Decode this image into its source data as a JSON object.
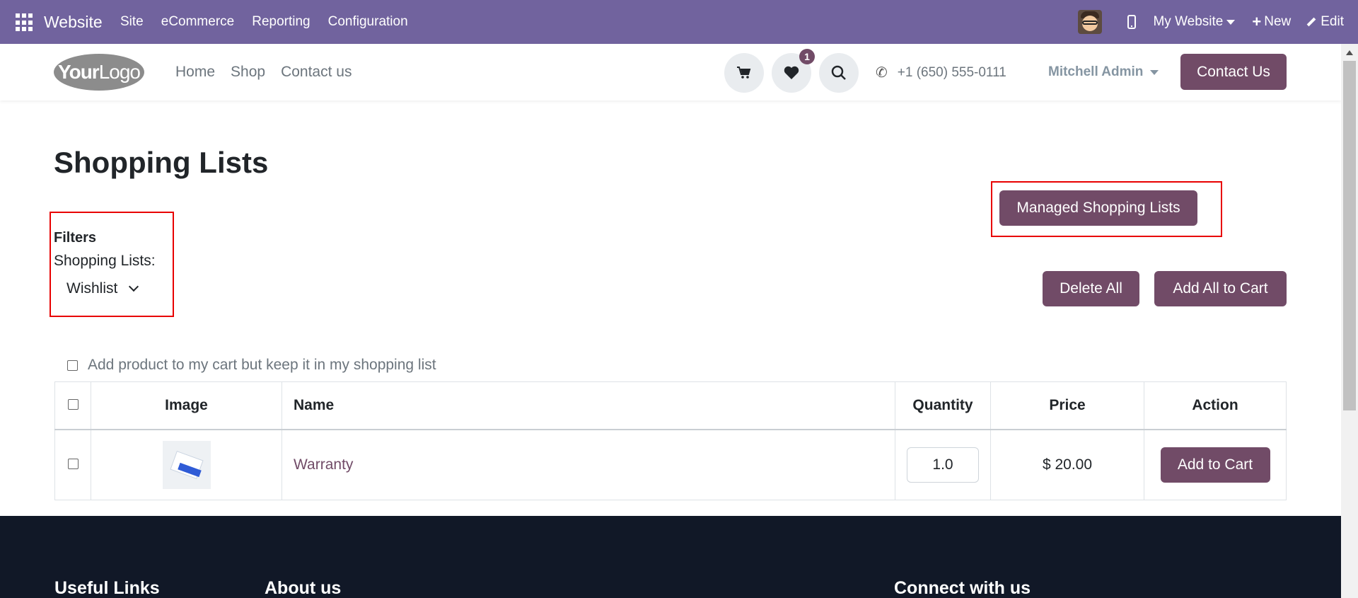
{
  "admin_bar": {
    "brand": "Website",
    "menu": [
      "Site",
      "eCommerce",
      "Reporting",
      "Configuration"
    ],
    "site_selector": "My Website",
    "new_label": "New",
    "edit_label": "Edit"
  },
  "header": {
    "logo_text_bold": "Your",
    "logo_text_light": "Logo",
    "nav": [
      "Home",
      "Shop",
      "Contact us"
    ],
    "wishlist_count": "1",
    "phone": "+1 (650) 555-0111",
    "user": "Mitchell Admin",
    "contact_button": "Contact Us"
  },
  "main": {
    "title": "Shopping Lists",
    "filters_title": "Filters",
    "filters_label": "Shopping Lists:",
    "selected_list": "Wishlist",
    "managed_button": "Managed Shopping Lists",
    "delete_all": "Delete All",
    "add_all": "Add All to Cart",
    "keep_option": "Add product to my cart but keep it in my shopping list"
  },
  "table": {
    "headers": [
      "Image",
      "Name",
      "Quantity",
      "Price",
      "Action"
    ],
    "rows": [
      {
        "name": "Warranty",
        "quantity": "1.0",
        "price": "$ 20.00",
        "action": "Add to Cart"
      }
    ]
  },
  "footer": {
    "headings": [
      "Useful Links",
      "About us",
      "Connect with us"
    ]
  },
  "colors": {
    "admin_bar": "#71639e",
    "primary": "#714b67",
    "highlight_box": "#e80000",
    "footer": "#111827"
  }
}
